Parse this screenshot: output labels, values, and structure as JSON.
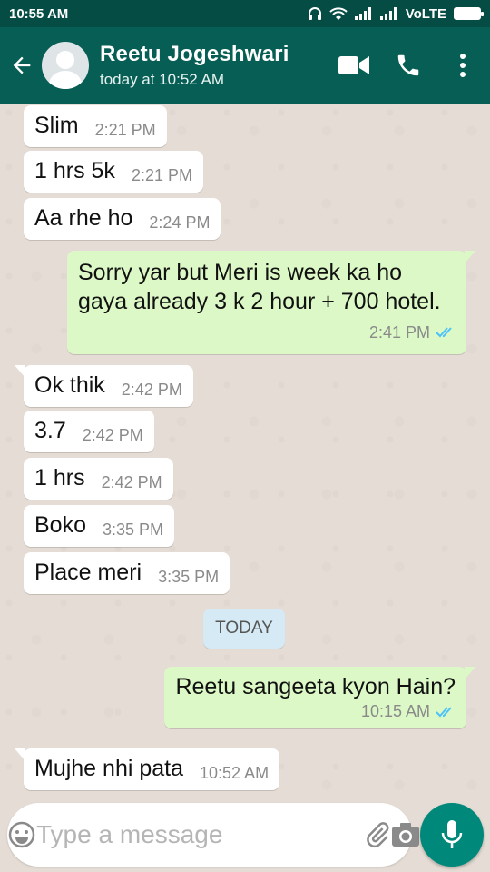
{
  "status_bar": {
    "time": "10:55 AM",
    "network": "VoLTE"
  },
  "header": {
    "name": "Reetu Jogeshwari",
    "last_seen": "today at 10:52 AM"
  },
  "messages": [
    {
      "text": "Slim",
      "time": "2:21 PM"
    },
    {
      "text": "1 hrs 5k",
      "time": "2:21 PM"
    },
    {
      "text": "Aa rhe ho",
      "time": "2:24 PM"
    },
    {
      "text": "Sorry yar but Meri is week ka ho gaya already 3 k 2 hour + 700 hotel.",
      "time": "2:41 PM"
    },
    {
      "text": "Ok thik",
      "time": "2:42 PM"
    },
    {
      "text": "3.7",
      "time": "2:42 PM"
    },
    {
      "text": "1 hrs",
      "time": "2:42 PM"
    },
    {
      "text": "Boko",
      "time": "3:35 PM"
    },
    {
      "text": "Place meri",
      "time": "3:35 PM"
    },
    {
      "text": "Reetu sangeeta kyon Hain?",
      "time": "10:15 AM"
    },
    {
      "text": "Mujhe nhi pata",
      "time": "10:52 AM"
    }
  ],
  "date_divider": "TODAY",
  "composer": {
    "placeholder": "Type a message"
  },
  "colors": {
    "header": "#075e54",
    "statusbar": "#054d44",
    "outgoing": "#dcf8c6",
    "incoming": "#ffffff",
    "accent": "#00897b",
    "read_ticks": "#4fc3f7"
  },
  "icons": [
    "back-arrow-icon",
    "video-call-icon",
    "phone-icon",
    "more-vert-icon",
    "emoji-icon",
    "attach-icon",
    "camera-icon",
    "mic-icon",
    "double-tick-icon"
  ]
}
